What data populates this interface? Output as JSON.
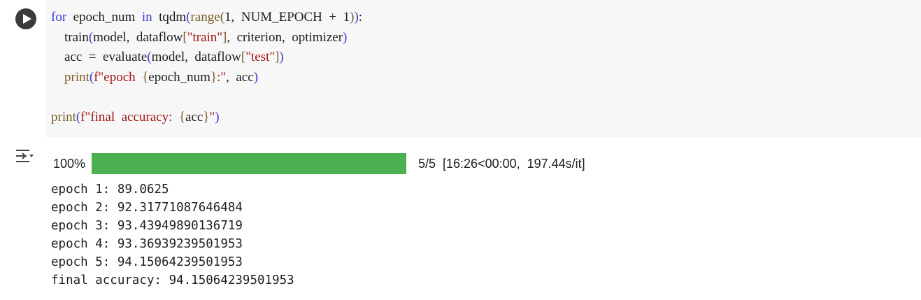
{
  "cell": {
    "code_lines": [
      [
        {
          "t": "for",
          "c": "kw"
        },
        {
          "t": "  epoch_num  ",
          "c": ""
        },
        {
          "t": "in",
          "c": "kw"
        },
        {
          "t": "  tqdm",
          "c": ""
        },
        {
          "t": "(",
          "c": "br"
        },
        {
          "t": "range",
          "c": "fn"
        },
        {
          "t": "(",
          "c": "pb"
        },
        {
          "t": "1,  NUM_EPOCH  +  1",
          "c": ""
        },
        {
          "t": ")",
          "c": "pb"
        },
        {
          "t": ")",
          "c": "br"
        },
        {
          "t": ":",
          "c": ""
        }
      ],
      [
        {
          "t": "    train",
          "c": ""
        },
        {
          "t": "(",
          "c": "br"
        },
        {
          "t": "model,  dataflow",
          "c": ""
        },
        {
          "t": "[",
          "c": "pb"
        },
        {
          "t": "\"train\"",
          "c": "st"
        },
        {
          "t": "]",
          "c": "pb"
        },
        {
          "t": ",  criterion,  optimizer",
          "c": ""
        },
        {
          "t": ")",
          "c": "br"
        }
      ],
      [
        {
          "t": "    acc  =  evaluate",
          "c": ""
        },
        {
          "t": "(",
          "c": "br"
        },
        {
          "t": "model,  dataflow",
          "c": ""
        },
        {
          "t": "[",
          "c": "pb"
        },
        {
          "t": "\"test\"",
          "c": "st"
        },
        {
          "t": "]",
          "c": "pb"
        },
        {
          "t": ")",
          "c": "br"
        }
      ],
      [
        {
          "t": "    ",
          "c": ""
        },
        {
          "t": "print",
          "c": "fn"
        },
        {
          "t": "(",
          "c": "br"
        },
        {
          "t": "f\"epoch  ",
          "c": "st"
        },
        {
          "t": "{",
          "c": "pb"
        },
        {
          "t": "epoch_num",
          "c": ""
        },
        {
          "t": "}",
          "c": "pb"
        },
        {
          "t": ":\"",
          "c": "st"
        },
        {
          "t": ",  acc",
          "c": ""
        },
        {
          "t": ")",
          "c": "br"
        }
      ],
      [],
      [
        {
          "t": "print",
          "c": "fn"
        },
        {
          "t": "(",
          "c": "br"
        },
        {
          "t": "f\"final  accuracy:  ",
          "c": "st"
        },
        {
          "t": "{",
          "c": "pb"
        },
        {
          "t": "acc",
          "c": ""
        },
        {
          "t": "}",
          "c": "pb"
        },
        {
          "t": "\"",
          "c": "st"
        },
        {
          "t": ")",
          "c": "br"
        }
      ]
    ]
  },
  "progress": {
    "percent_label": "100%",
    "fraction": 1.0,
    "stats": "5/5  [16:26<00:00,  197.44s/it]",
    "bar_color": "#4caf50"
  },
  "output_lines": [
    "epoch 1: 89.0625",
    "epoch 2: 92.31771087646484",
    "epoch 3: 93.43949890136719",
    "epoch 4: 93.36939239501953",
    "epoch 5: 94.15064239501953",
    "final accuracy: 94.15064239501953"
  ],
  "icons": {
    "run": "play-icon",
    "output_toggle": "output-toggle-icon"
  },
  "colors": {
    "keyword": "#3b3bd6",
    "string": "#a31515",
    "function": "#795e26",
    "cell_background": "#f7f7f7"
  }
}
